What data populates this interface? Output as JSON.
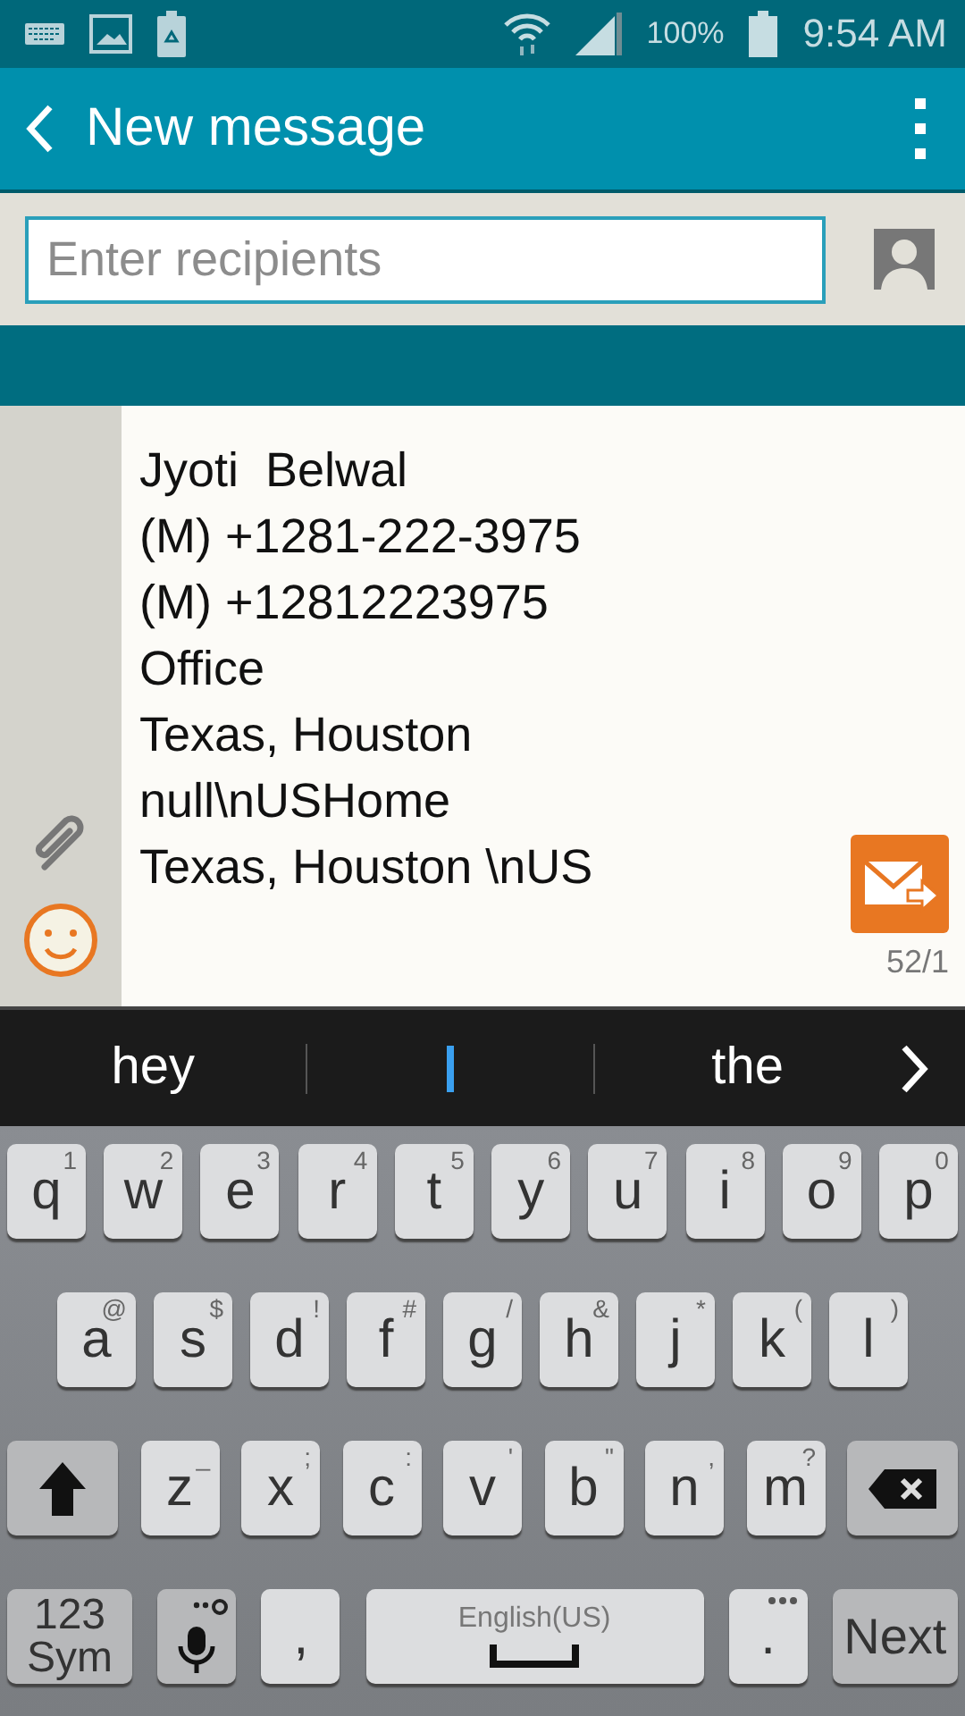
{
  "status_bar": {
    "battery_text": "100%",
    "time": "9:54 AM"
  },
  "app_bar": {
    "title": "New message"
  },
  "recipients": {
    "placeholder": "Enter recipients"
  },
  "message": {
    "lines": [
      "Jyoti  Belwal",
      "(M) +1281-222-3975",
      "(M) +12812223975",
      "Office",
      "Texas, Houston",
      "null\\nUSHome",
      "Texas, Houston \\nUS"
    ],
    "counter": "52/1"
  },
  "suggestions": [
    "hey",
    "the"
  ],
  "keyboard": {
    "rows": [
      {
        "keys": [
          {
            "kind": "char",
            "label": "q",
            "hint": "1"
          },
          {
            "kind": "char",
            "label": "w",
            "hint": "2"
          },
          {
            "kind": "char",
            "label": "e",
            "hint": "3"
          },
          {
            "kind": "char",
            "label": "r",
            "hint": "4"
          },
          {
            "kind": "char",
            "label": "t",
            "hint": "5"
          },
          {
            "kind": "char",
            "label": "y",
            "hint": "6"
          },
          {
            "kind": "char",
            "label": "u",
            "hint": "7"
          },
          {
            "kind": "char",
            "label": "i",
            "hint": "8"
          },
          {
            "kind": "char",
            "label": "o",
            "hint": "9"
          },
          {
            "kind": "char",
            "label": "p",
            "hint": "0"
          }
        ]
      },
      {
        "keys": [
          {
            "kind": "char",
            "label": "a",
            "hint": "@"
          },
          {
            "kind": "char",
            "label": "s",
            "hint": "$"
          },
          {
            "kind": "char",
            "label": "d",
            "hint": "!"
          },
          {
            "kind": "char",
            "label": "f",
            "hint": "#"
          },
          {
            "kind": "char",
            "label": "g",
            "hint": "/"
          },
          {
            "kind": "char",
            "label": "h",
            "hint": "&"
          },
          {
            "kind": "char",
            "label": "j",
            "hint": "*"
          },
          {
            "kind": "char",
            "label": "k",
            "hint": "("
          },
          {
            "kind": "char",
            "label": "l",
            "hint": ")"
          }
        ]
      },
      {
        "keys": [
          {
            "kind": "shift"
          },
          {
            "kind": "char",
            "label": "z",
            "hint": "_"
          },
          {
            "kind": "char",
            "label": "x",
            "hint": ";"
          },
          {
            "kind": "char",
            "label": "c",
            "hint": ":"
          },
          {
            "kind": "char",
            "label": "v",
            "hint": "'"
          },
          {
            "kind": "char",
            "label": "b",
            "hint": "\""
          },
          {
            "kind": "char",
            "label": "n",
            "hint": ","
          },
          {
            "kind": "char",
            "label": "m",
            "hint": "?"
          },
          {
            "kind": "backspace"
          }
        ]
      },
      {
        "keys": [
          {
            "kind": "sym",
            "label": "123",
            "label2": "Sym"
          },
          {
            "kind": "mic"
          },
          {
            "kind": "char",
            "label": ","
          },
          {
            "kind": "space",
            "label": "English(US)"
          },
          {
            "kind": "period",
            "label": "."
          },
          {
            "kind": "action",
            "label": "Next"
          }
        ]
      }
    ]
  }
}
